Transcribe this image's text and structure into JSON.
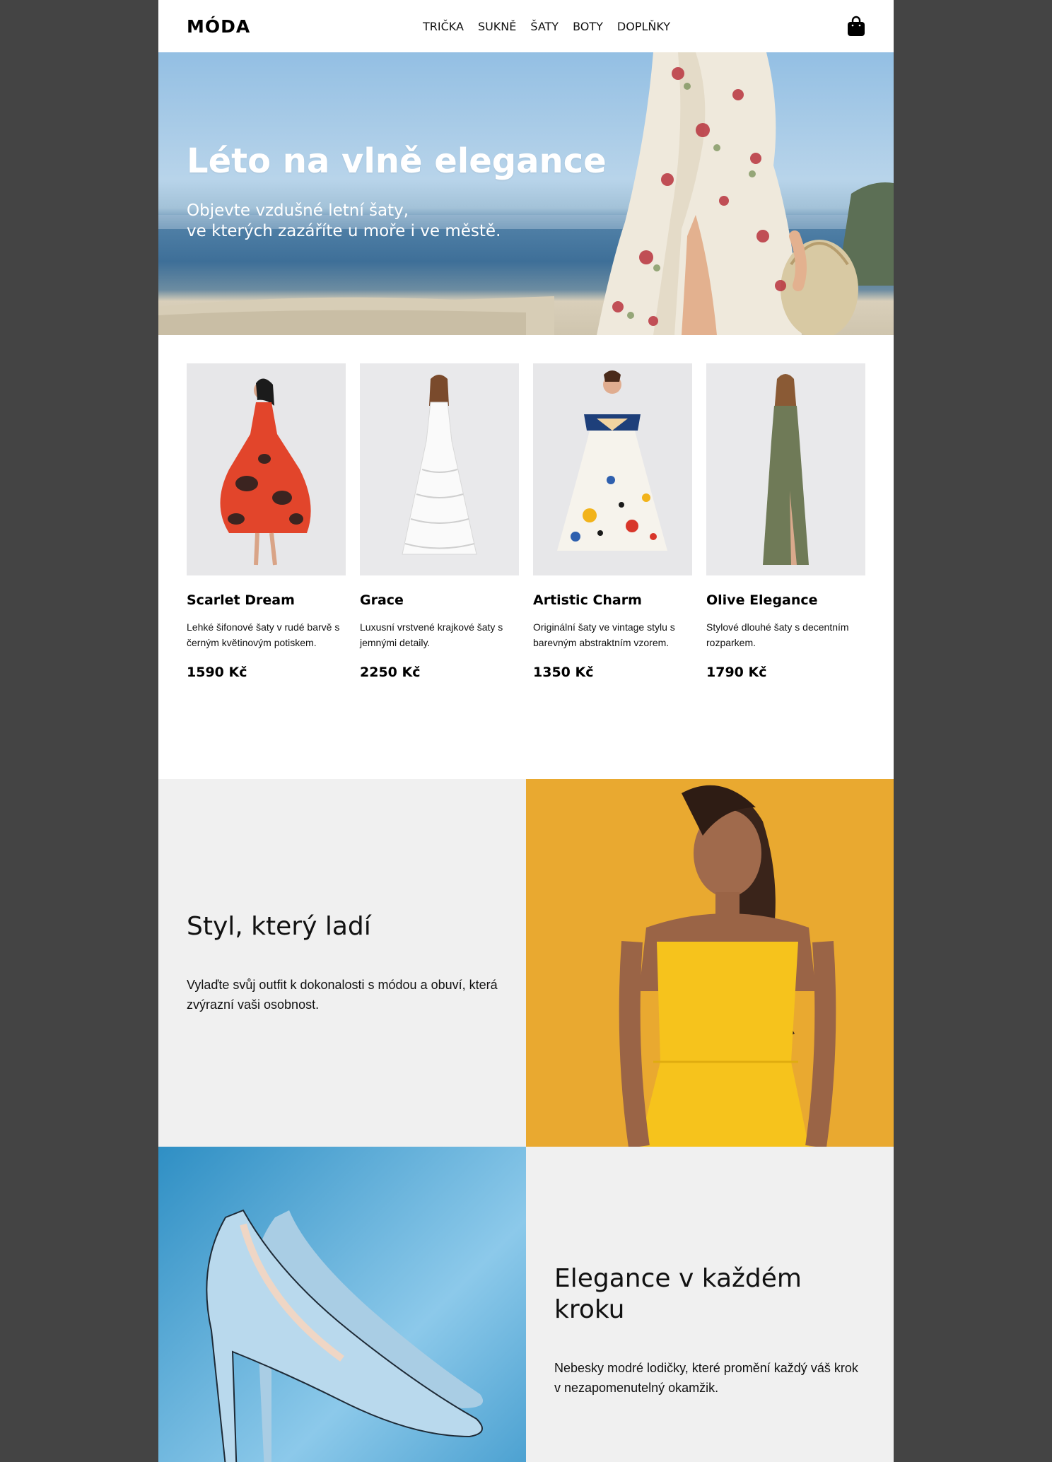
{
  "brand": {
    "logo": "MÓDA"
  },
  "nav": {
    "items": [
      "TRIČKA",
      "SUKNĚ",
      "ŠATY",
      "BOTY",
      "DOPLŇKY"
    ],
    "cart_icon": "shopping-bag-icon"
  },
  "hero": {
    "title": "Léto na vlně elegance",
    "subtitle_line1": "Objevte vzdušné letní šaty,",
    "subtitle_line2": "ve kterých zazáříte u moře i ve městě."
  },
  "products": [
    {
      "name": "Scarlet Dream",
      "description": "Lehké šifonové šaty v rudé barvě s černým květinovým potiskem.",
      "price": "1590 Kč",
      "color": "#e2452b"
    },
    {
      "name": "Grace",
      "description": "Luxusní vrstvené krajkové šaty s jemnými detaily.",
      "price": "2250 Kč",
      "color": "#f7f7f5"
    },
    {
      "name": "Artistic Charm",
      "description": "Originální šaty ve vintage stylu s barevným abstraktním vzorem.",
      "price": "1350 Kč",
      "color": "#f4f1ea"
    },
    {
      "name": "Olive Elegance",
      "description": "Stylové dlouhé šaty s decentním rozparkem.",
      "price": "1790 Kč",
      "color": "#6f7a57"
    }
  ],
  "feature1": {
    "title": "Styl, který ladí",
    "body": "Vylaďte svůj outfit k dokonalosti s módou a obuví, která zvýrazní vaši osobnost.",
    "image_color": "#e9a930"
  },
  "feature2": {
    "title": "Elegance v každém kroku",
    "body": "Nebesky modré lodičky, které promění každý váš krok v nezapomenutelný okamžik.",
    "image_color": "#3d9bcb"
  }
}
